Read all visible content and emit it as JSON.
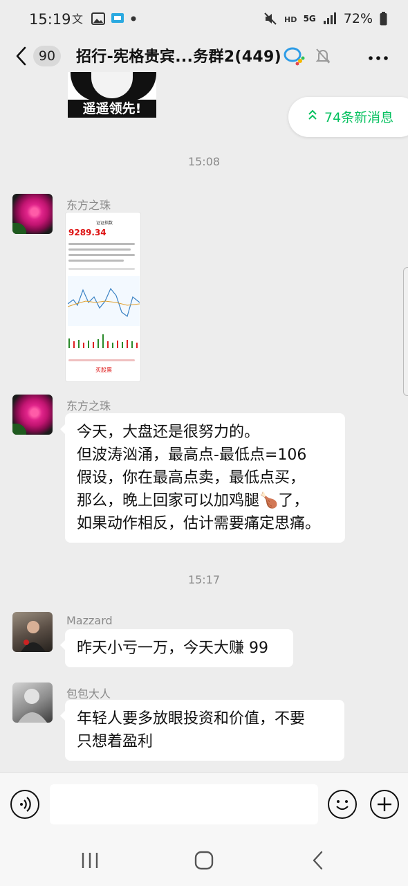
{
  "status_bar": {
    "time": "15:19",
    "network": "5G",
    "battery": "72%",
    "icons": [
      "translate-icon",
      "gallery-icon",
      "screen-icon",
      "dot-icon",
      "mute-icon",
      "hd-icon",
      "signal-icon",
      "battery-icon"
    ]
  },
  "header": {
    "unread_count": "90",
    "title": "招行-宪格贵宾...务群2(449)"
  },
  "sticker": {
    "caption": "遥遥领先!"
  },
  "new_messages": {
    "label": "74条新消息"
  },
  "messages": [
    {
      "type": "timestamp",
      "text": "15:08"
    },
    {
      "type": "image",
      "sender": "东方之珠",
      "thumbnail": {
        "title": "证证指数",
        "price": "9289.34",
        "button": "买股票"
      }
    },
    {
      "type": "text",
      "sender": "东方之珠",
      "lines": [
        "今天，大盘还是很努力的。",
        "但波涛汹涌，最高点-最低点=106",
        "假设，你在最高点卖，最低点买，",
        "那么，晚上回家可以加鸡腿🍗了，",
        "如果动作相反，估计需要痛定思痛。"
      ]
    },
    {
      "type": "timestamp",
      "text": "15:17"
    },
    {
      "type": "text",
      "sender": "Mazzard",
      "lines": [
        "昨天小亏一万，今天大赚 99"
      ]
    },
    {
      "type": "text",
      "sender": "包包大人",
      "lines": [
        "年轻人要多放眼投资和价值，不要",
        "只想着盈利"
      ]
    }
  ],
  "colors": {
    "accent_green": "#07c160",
    "background": "#ededed",
    "bubble": "#ffffff"
  }
}
